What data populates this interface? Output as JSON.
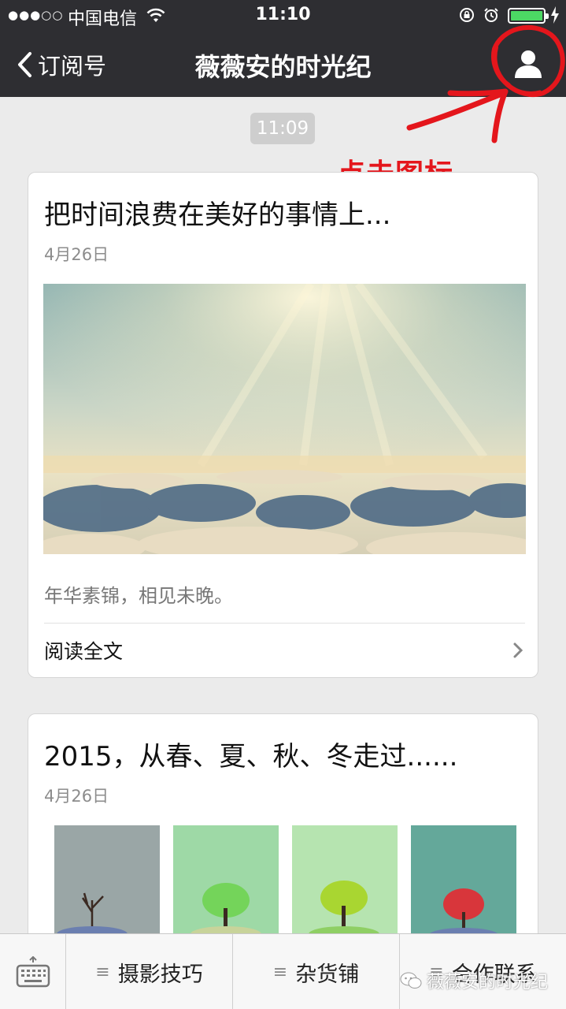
{
  "status_bar": {
    "signal": "●●●○○",
    "carrier": "中国电信",
    "time": "11:10"
  },
  "nav": {
    "back_label": "订阅号",
    "title": "薇薇安的时光纪"
  },
  "annotation": {
    "text": "点击图标",
    "color": "#e4161c"
  },
  "feed": {
    "time_badge": "11:09",
    "articles": [
      {
        "title": "把时间浪费在美好的事情上...",
        "date": "4月26日",
        "summary": "年华素锦，相见未晚。",
        "read_more": "阅读全文"
      },
      {
        "title": "2015，从春、夏、秋、冬走过......",
        "date": "4月26日"
      }
    ]
  },
  "bottom_menu": {
    "items": [
      "摄影技巧",
      "杂货铺",
      "合作联系"
    ],
    "hamburger": "≡"
  },
  "watermark": "薇薇安的时光纪",
  "colors": {
    "nav_bg": "#2e2e32",
    "page_bg": "#ebebeb",
    "battery": "#4cd964"
  }
}
